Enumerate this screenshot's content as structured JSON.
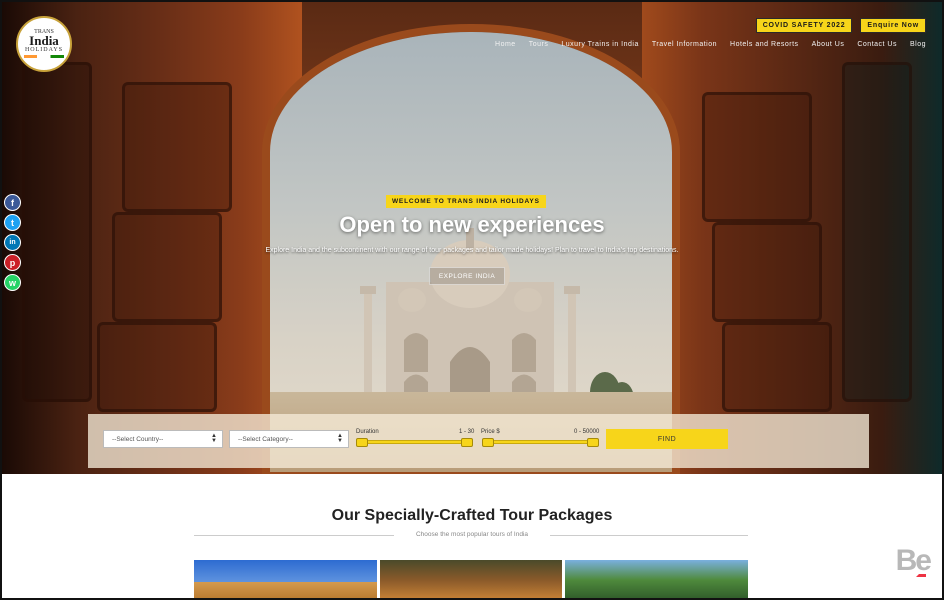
{
  "brand": {
    "logo_top": "TRANS",
    "logo_main": "India",
    "logo_bottom": "HOLIDAYS"
  },
  "topbar": {
    "covid_label": "COVID SAFETY 2022",
    "enquire_label": "Enquire Now"
  },
  "nav": {
    "items": [
      {
        "label": "Home"
      },
      {
        "label": "Tours"
      },
      {
        "label": "Luxury Trains in India"
      },
      {
        "label": "Travel Information"
      },
      {
        "label": "Hotels and Resorts"
      },
      {
        "label": "About Us"
      },
      {
        "label": "Contact Us"
      },
      {
        "label": "Blog"
      }
    ]
  },
  "social": [
    {
      "icon": "facebook-icon",
      "glyph": "f",
      "color": "#3b5998"
    },
    {
      "icon": "twitter-icon",
      "glyph": "t",
      "color": "#1da1f2"
    },
    {
      "icon": "linkedin-icon",
      "glyph": "in",
      "color": "#0077b5"
    },
    {
      "icon": "pinterest-icon",
      "glyph": "p",
      "color": "#cb2027"
    },
    {
      "icon": "whatsapp-icon",
      "glyph": "w",
      "color": "#25d366"
    }
  ],
  "hero": {
    "welcome": "WELCOME TO TRANS INDIA HOLIDAYS",
    "headline": "Open to new experiences",
    "subtext": "Explore India and the subcontinent with our range of tour packages and tailor made holidays! Plan to travel to India's top destinations.",
    "cta": "EXPLORE INDIA"
  },
  "search": {
    "country_placeholder": "--Select Country--",
    "category_placeholder": "--Select Category--",
    "duration_label": "Duration",
    "duration_range": "1 - 30",
    "price_label": "Price $",
    "price_range": "0 - 50000",
    "find_label": "FIND"
  },
  "packages": {
    "title": "Our Specially-Crafted Tour Packages",
    "subtitle": "Choose the most popular tours of India"
  },
  "colors": {
    "accent": "#f7d51a",
    "nav_text": "#f2f2f2"
  }
}
